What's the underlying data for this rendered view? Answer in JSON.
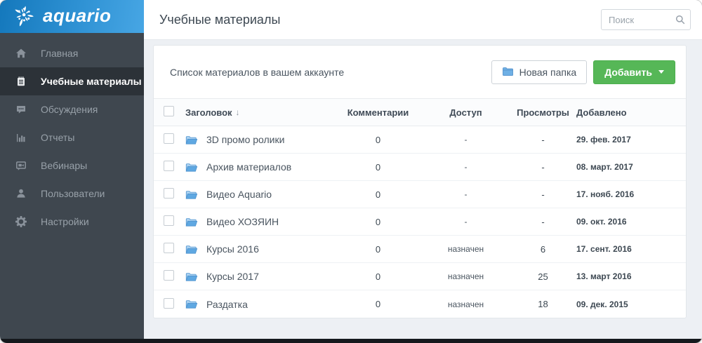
{
  "brand": {
    "name": "aquario"
  },
  "sidebar": {
    "items": [
      {
        "label": "Главная"
      },
      {
        "label": "Учебные материалы"
      },
      {
        "label": "Обсуждения"
      },
      {
        "label": "Отчеты"
      },
      {
        "label": "Вебинары"
      },
      {
        "label": "Пользователи"
      },
      {
        "label": "Настройки"
      }
    ]
  },
  "topbar": {
    "title": "Учебные материалы",
    "search_placeholder": "Поиск"
  },
  "toolbar": {
    "caption": "Список материалов в вашем аккаунте",
    "new_folder_label": "Новая папка",
    "add_label": "Добавить"
  },
  "table": {
    "headers": {
      "title": "Заголовок",
      "sort_indicator": "↓",
      "comments": "Комментарии",
      "access": "Доступ",
      "views": "Просмотры",
      "added": "Добавлено"
    },
    "rows": [
      {
        "name": "3D промо ролики",
        "comments": "0",
        "access": "-",
        "views": "-",
        "added": "29. фев. 2017"
      },
      {
        "name": "Архив материалов",
        "comments": "0",
        "access": "-",
        "views": "-",
        "added": "08. март. 2017"
      },
      {
        "name": "Видео Aquario",
        "comments": "0",
        "access": "-",
        "views": "-",
        "added": "17. нояб. 2016"
      },
      {
        "name": "Видео ХОЗЯИН",
        "comments": "0",
        "access": "-",
        "views": "-",
        "added": "09. окт. 2016"
      },
      {
        "name": "Курсы 2016",
        "comments": "0",
        "access": "назначен",
        "views": "6",
        "added": "17. сент. 2016"
      },
      {
        "name": "Курсы 2017",
        "comments": "0",
        "access": "назначен",
        "views": "25",
        "added": "13. март 2016"
      },
      {
        "name": "Раздатка",
        "comments": "0",
        "access": "назначен",
        "views": "18",
        "added": "09. дек. 2015"
      }
    ]
  },
  "colors": {
    "brand_gradient_start": "#1478bc",
    "brand_gradient_end": "#47a6e4",
    "sidebar_bg": "#3f474f",
    "sidebar_active_bg": "#2c3238",
    "accent_green": "#56b757",
    "folder_blue": "#5fa8e2",
    "content_bg": "#edf0f4"
  }
}
